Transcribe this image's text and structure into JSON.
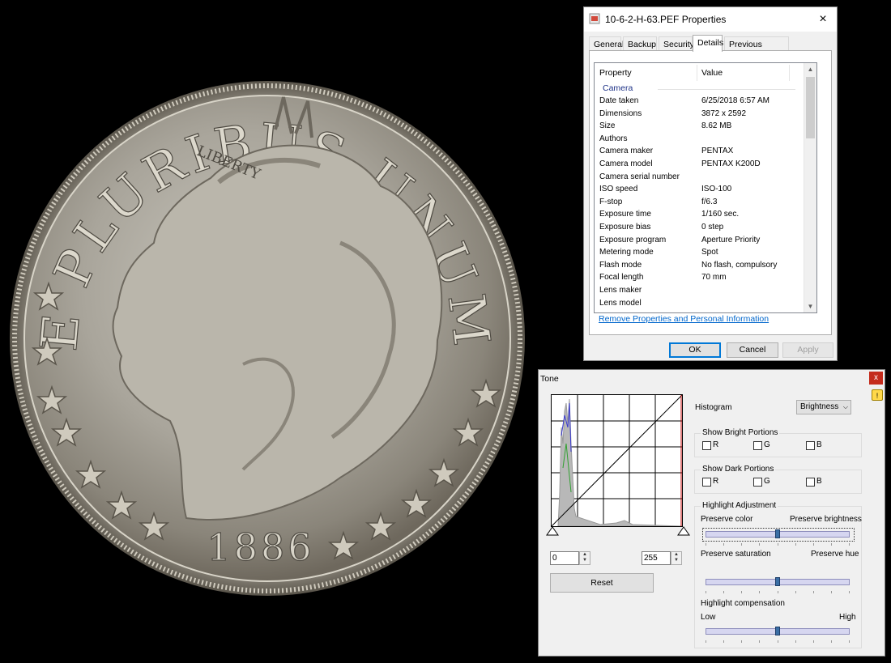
{
  "coin": {
    "legend": "E PLURIBUS UNUM",
    "liberty": "LIBERTY",
    "year": "1886"
  },
  "properties_dialog": {
    "title": "10-6-2-H-63.PEF Properties",
    "close_label": "×",
    "tabs": [
      {
        "label": "General",
        "active": false
      },
      {
        "label": "Backup",
        "active": false
      },
      {
        "label": "Security",
        "active": false
      },
      {
        "label": "Details",
        "active": true
      },
      {
        "label": "Previous Versions",
        "active": false
      }
    ],
    "columns": {
      "property": "Property",
      "value": "Value"
    },
    "group": "Camera",
    "rows": [
      {
        "key": "Date taken",
        "value": "6/25/2018 6:57 AM"
      },
      {
        "key": "Dimensions",
        "value": "3872 x 2592"
      },
      {
        "key": "Size",
        "value": "8.62 MB"
      },
      {
        "key": "Authors",
        "value": ""
      },
      {
        "key": "Camera maker",
        "value": "PENTAX"
      },
      {
        "key": "Camera model",
        "value": "PENTAX K200D"
      },
      {
        "key": "Camera serial number",
        "value": ""
      },
      {
        "key": "ISO speed",
        "value": "ISO-100"
      },
      {
        "key": "F-stop",
        "value": "f/6.3"
      },
      {
        "key": "Exposure time",
        "value": "1/160 sec."
      },
      {
        "key": "Exposure bias",
        "value": "0 step"
      },
      {
        "key": "Exposure program",
        "value": "Aperture Priority"
      },
      {
        "key": "Metering mode",
        "value": "Spot"
      },
      {
        "key": "Flash mode",
        "value": "No flash, compulsory"
      },
      {
        "key": "Focal length",
        "value": "70 mm"
      },
      {
        "key": "Lens maker",
        "value": ""
      },
      {
        "key": "Lens model",
        "value": ""
      }
    ],
    "remove_link": "Remove Properties and Personal Information",
    "ok_label": "OK",
    "cancel_label": "Cancel",
    "apply_label": "Apply"
  },
  "tone_window": {
    "title": "Tone",
    "close_label": "x",
    "histogram_label": "Histogram",
    "histogram_mode": "Brightness",
    "show_bright": {
      "title": "Show Bright Portions",
      "r": "R",
      "g": "G",
      "b": "B"
    },
    "show_dark": {
      "title": "Show Dark Portions",
      "r": "R",
      "g": "G",
      "b": "B"
    },
    "highlight": {
      "title": "Highlight Adjustment",
      "preserve_color": "Preserve color",
      "preserve_brightness": "Preserve brightness",
      "preserve_saturation": "Preserve saturation",
      "preserve_hue": "Preserve hue",
      "compensation": "Highlight compensation",
      "low": "Low",
      "high": "High",
      "slider1_level": 0.5,
      "slider2_level": 0.5,
      "slider3_level": 0.5
    },
    "input_low": "0",
    "input_high": "255",
    "reset_label": "Reset"
  }
}
